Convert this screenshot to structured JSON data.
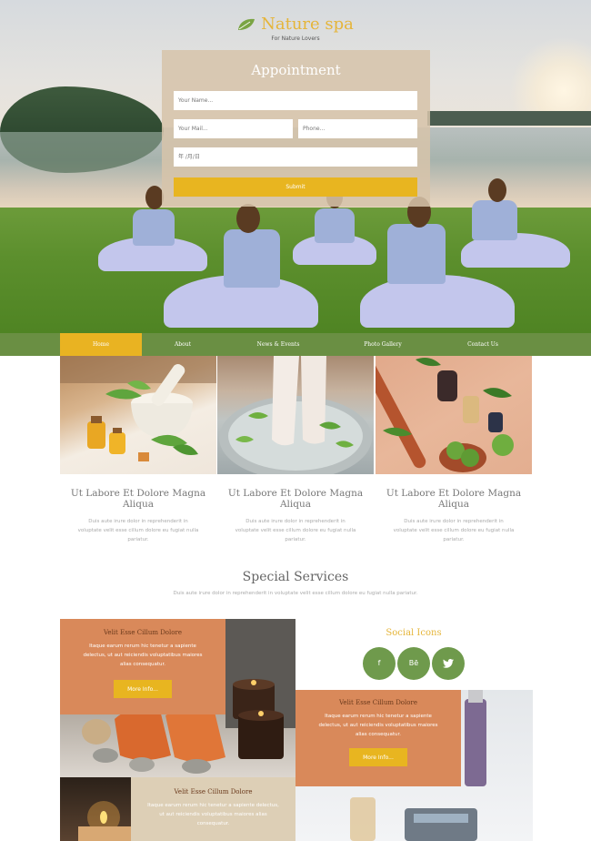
{
  "brand": {
    "title": "Nature spa",
    "tagline": "For Nature Lovers"
  },
  "appointment": {
    "title": "Appointment",
    "name_placeholder": "Your Name...",
    "mail_placeholder": "Your Mail...",
    "phone_placeholder": "Phone...",
    "date_placeholder": "年 /月/日",
    "submit_label": "Submit"
  },
  "nav": {
    "items": [
      {
        "label": "Home",
        "active": true
      },
      {
        "label": "About",
        "active": false
      },
      {
        "label": "News & Events",
        "active": false
      },
      {
        "label": "Photo Gallery",
        "active": false
      },
      {
        "label": "Contact Us",
        "active": false
      }
    ]
  },
  "features": [
    {
      "title": "Ut Labore Et Dolore Magna Aliqua",
      "text": "Duis aute irure dolor in reprehenderit in voluptate velit esse cillum dolore eu fugiat nulla pariatur."
    },
    {
      "title": "Ut Labore Et Dolore Magna Aliqua",
      "text": "Duis aute irure dolor in reprehenderit in voluptate velit esse cillum dolore eu fugiat nulla pariatur."
    },
    {
      "title": "Ut Labore Et Dolore Magna Aliqua",
      "text": "Duis aute irure dolor in reprehenderit in voluptate velit esse cillum dolore eu fugiat nulla pariatur."
    }
  ],
  "special": {
    "title": "Special Services",
    "subtitle": "Duis aute irure dolor in reprehenderit in voluptate velit esse cillum dolore eu fugiat nulla pariatur."
  },
  "services": [
    {
      "title": "Velit Esse Cillum Dolore",
      "text": "Itaque earum rerum hic tenetur a sapiente delectus, ut aut reiciendis voluptatibus maiores alias consequatur.",
      "button": "More Info..."
    },
    {
      "title": "Velit Esse Cillum Dolore",
      "text": "Itaque earum rerum hic tenetur a sapiente delectus, ut aut reiciendis voluptatibus maiores alias consequatur.",
      "button": "More Info..."
    },
    {
      "title": "Velit Esse Cillum Dolore",
      "text": "Itaque earum rerum hic tenetur a sapiente delectus, ut aut reiciendis voluptatibus maiores alias consequatur."
    }
  ],
  "social": {
    "title": "Social Icons",
    "icons": [
      {
        "name": "facebook-icon",
        "glyph": "f"
      },
      {
        "name": "behance-icon",
        "glyph": "Bē"
      },
      {
        "name": "twitter-icon",
        "glyph": "🐦"
      }
    ]
  },
  "colors": {
    "accent": "#e8b520",
    "green": "#6a8f43",
    "orange": "#d9895a",
    "gold_text": "#e5b53a"
  }
}
